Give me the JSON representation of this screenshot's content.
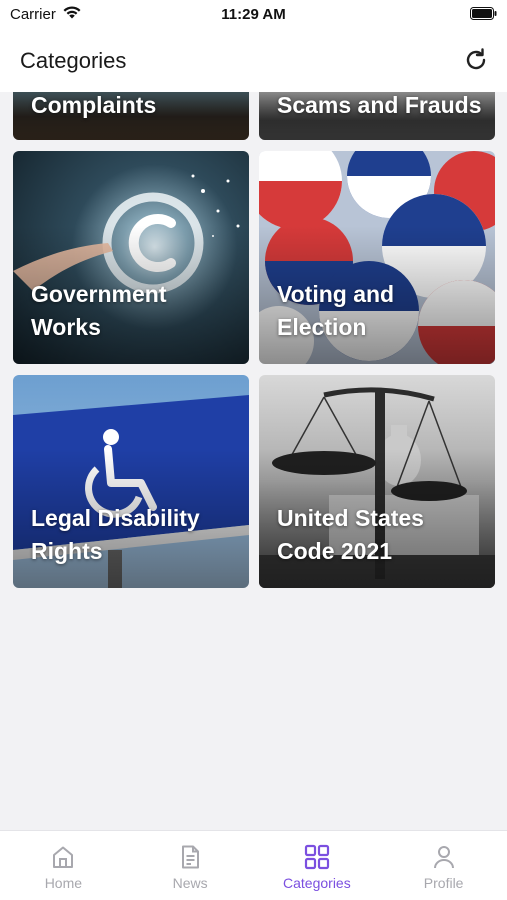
{
  "status_bar": {
    "carrier": "Carrier",
    "time": "11:29 AM"
  },
  "header": {
    "title": "Categories",
    "refresh_icon": "refresh-icon"
  },
  "categories": [
    {
      "label": "Complaints",
      "image": "complaints-photo"
    },
    {
      "label": "Scams and Frauds",
      "image": "scams-photo"
    },
    {
      "label": "Government\nWorks",
      "image": "copyright-hand-photo"
    },
    {
      "label": "Voting and\nElection",
      "image": "vote-buttons-photo"
    },
    {
      "label": "Legal Disability\nRights",
      "image": "wheelchair-sign-photo"
    },
    {
      "label": "United States\nCode 2021",
      "image": "scales-capitol-photo"
    }
  ],
  "tab_bar": {
    "tabs": [
      {
        "label": "Home",
        "icon": "home-icon",
        "active": false
      },
      {
        "label": "News",
        "icon": "news-icon",
        "active": false
      },
      {
        "label": "Categories",
        "icon": "grid-icon",
        "active": true
      },
      {
        "label": "Profile",
        "icon": "profile-icon",
        "active": false
      }
    ]
  },
  "colors": {
    "accent": "#7b4fe0",
    "inactive": "#a8a8ae",
    "background": "#f2f2f4"
  }
}
